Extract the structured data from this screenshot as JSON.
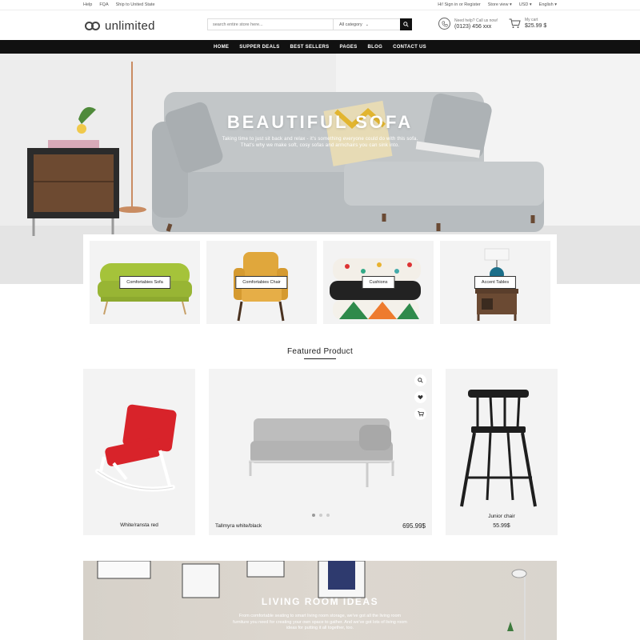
{
  "topbar": {
    "links": [
      "Help",
      "FQA",
      "Ship to United State"
    ],
    "signin": "Hi! Sign in or Register",
    "store_view": "Store view",
    "currency": "USD",
    "language": "English"
  },
  "header": {
    "logo": "unlimited",
    "search_placeholder": "search entire store here...",
    "category": "All category",
    "help_label": "Need help? Call us now!",
    "phone": "(0123) 456 xxx",
    "cart_label": "My cart",
    "cart_total": "$25.99 $"
  },
  "nav": [
    "HOME",
    "SUPPER DEALS",
    "BEST SELLERS",
    "PAGES",
    "BLOG",
    "CONTACT US"
  ],
  "hero": {
    "title": "BEAUTIFUL SOFA",
    "subtitle": "Taking time to just sit back and relax - it's something everyone could do with this sofa. That's why we make soft, cosy sofas and armchairs you can sink into."
  },
  "categories": [
    {
      "label": "Comfortabies Sofa"
    },
    {
      "label": "Comfortabies Chair"
    },
    {
      "label": "Cushions"
    },
    {
      "label": "Accent Tables"
    }
  ],
  "featured": {
    "title": "Featured Product",
    "products": [
      {
        "name": "White/ransta red",
        "price": ""
      },
      {
        "name": "Tallmyra white/black",
        "price": "695.99$"
      },
      {
        "name": "Junior chair",
        "price": "55.99$"
      }
    ]
  },
  "living": {
    "title": "LIVING ROOM IDEAS",
    "subtitle": "From comfortable seating to smart living room storage, we've got all the living room furniture you need for creating your own space to gather. And we've got lots of living room ideas for putting it all together, too."
  },
  "colors": {
    "nav_bg": "#111111",
    "accent_red": "#d8232a",
    "sofa_green": "#a5c33a",
    "chair_mustard": "#e0a73c"
  },
  "icons": [
    "search-icon",
    "phone-icon",
    "cart-icon",
    "zoom-icon",
    "heart-icon",
    "add-to-cart-icon",
    "chevron-down-icon"
  ]
}
